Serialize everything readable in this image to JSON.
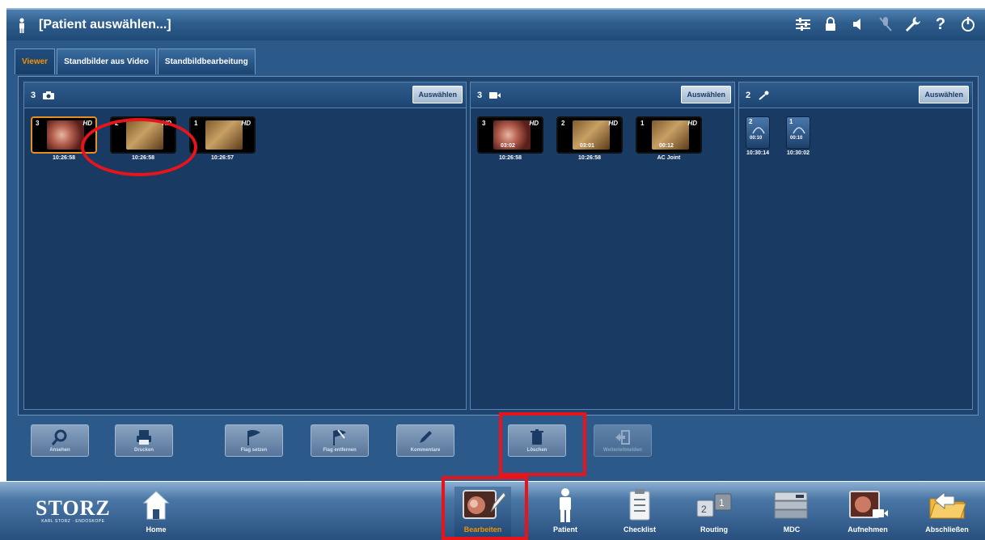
{
  "header": {
    "title": "[Patient auswählen...]",
    "icons": [
      "person-icon",
      "settings-sliders-icon",
      "lock-icon",
      "speaker-icon",
      "microphone-muted-icon",
      "wrench-icon",
      "help-icon",
      "power-icon"
    ],
    "help_glyph": "?",
    "power_glyph": "⏻"
  },
  "tabs": [
    {
      "label": "Viewer",
      "active": true
    },
    {
      "label": "Standbilder aus Video",
      "active": false
    },
    {
      "label": "Standbildbearbeitung",
      "active": false
    }
  ],
  "panels": {
    "images": {
      "count": "3",
      "icon": "camera-icon",
      "select_label": "Auswählen",
      "items": [
        {
          "num": "3",
          "hd": "HD",
          "time": "10:26:58",
          "pic": "red",
          "selected": true
        },
        {
          "num": "2",
          "hd": "HD",
          "time": "10:26:58",
          "pic": "orange",
          "selected": false
        },
        {
          "num": "1",
          "hd": "HD",
          "time": "10:26:57",
          "pic": "orange",
          "selected": false
        }
      ]
    },
    "videos": {
      "count": "3",
      "icon": "video-camera-icon",
      "select_label": "Auswählen",
      "items": [
        {
          "num": "3",
          "hd": "HD",
          "duration": "03:02",
          "time": "10:26:58",
          "pic": "red"
        },
        {
          "num": "2",
          "hd": "HD",
          "duration": "03:01",
          "time": "10:26:58",
          "pic": "orange"
        },
        {
          "num": "1",
          "hd": "HD",
          "duration": "00:12",
          "time": "AC Joint",
          "pic": "orange"
        }
      ]
    },
    "audio": {
      "count": "2",
      "icon": "microphone-icon",
      "select_label": "Auswählen",
      "items": [
        {
          "num": "2",
          "duration": "00:10",
          "time": "10:30:14"
        },
        {
          "num": "1",
          "duration": "00:10",
          "time": "10:30:02"
        }
      ]
    }
  },
  "actions": [
    {
      "label": "Ansehen",
      "icon": "magnifier-icon",
      "enabled": true
    },
    {
      "label": "Drucken",
      "icon": "printer-icon",
      "enabled": true
    },
    {
      "label": "Flag setzen",
      "icon": "flag-icon",
      "enabled": true
    },
    {
      "label": "Flag entfernen",
      "icon": "flag-remove-icon",
      "enabled": true
    },
    {
      "label": "Kommentare",
      "icon": "pen-icon",
      "enabled": true
    },
    {
      "label": "Löschen",
      "icon": "trash-icon",
      "enabled": true
    },
    {
      "label": "Weiterleitmelden",
      "icon": "export-icon",
      "enabled": false
    }
  ],
  "dock": {
    "logo_main": "STORZ",
    "logo_sub": "KARL STORZ · ENDOSKOPE",
    "items": [
      {
        "label": "Home",
        "icon": "home-icon",
        "active": false
      },
      {
        "label": "Bearbeiten",
        "icon": "edit-image-icon",
        "active": true
      },
      {
        "label": "Patient",
        "icon": "person-icon",
        "active": false
      },
      {
        "label": "Checklist",
        "icon": "checklist-icon",
        "active": false
      },
      {
        "label": "Routing",
        "icon": "routing-icon",
        "active": false
      },
      {
        "label": "MDC",
        "icon": "device-icon",
        "active": false
      },
      {
        "label": "Aufnehmen",
        "icon": "record-icon",
        "active": false
      },
      {
        "label": "Abschließen",
        "icon": "folder-icon",
        "active": false
      }
    ]
  },
  "colors": {
    "accent": "#f39200",
    "highlight": "#e8141b",
    "panel_bg": "#183a63"
  }
}
